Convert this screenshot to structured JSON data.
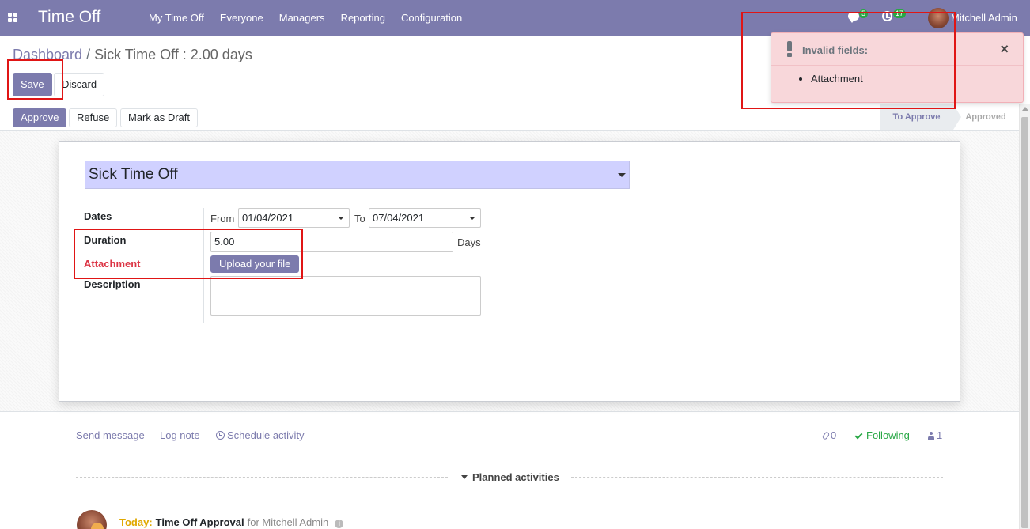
{
  "navbar": {
    "app_title": "Time Off",
    "menu": [
      "My Time Off",
      "Everyone",
      "Managers",
      "Reporting",
      "Configuration"
    ],
    "messages_count": "5",
    "activities_count": "17",
    "user_name": "Mitchell Admin"
  },
  "breadcrumb": {
    "parent": "Dashboard",
    "separator": "/",
    "current": "Sick Time Off : 2.00 days"
  },
  "toolbar": {
    "save_label": "Save",
    "discard_label": "Discard"
  },
  "statusbar": {
    "approve_label": "Approve",
    "refuse_label": "Refuse",
    "draft_label": "Mark as Draft",
    "stages": [
      "To Approve",
      "Approved"
    ],
    "active_stage": "To Approve"
  },
  "form": {
    "leave_type": "Sick Time Off",
    "dates_label": "Dates",
    "from_label": "From",
    "date_from": "01/04/2021",
    "to_label": "To",
    "date_to": "07/04/2021",
    "duration_label": "Duration",
    "duration_value": "5.00",
    "duration_unit": "Days",
    "attachment_label": "Attachment",
    "upload_label": "Upload your file",
    "description_label": "Description",
    "description_value": ""
  },
  "chatter": {
    "send_message": "Send message",
    "log_note": "Log note",
    "schedule_activity": "Schedule activity",
    "attachments_count": "0",
    "following_label": "Following",
    "followers_count": "1",
    "planned_activities_label": "Planned activities",
    "activity": {
      "due": "Today:",
      "title": "Time Off Approval",
      "assignee": "for Mitchell Admin"
    }
  },
  "notification": {
    "title": "Invalid fields:",
    "close": "×",
    "fields": [
      "Attachment"
    ]
  },
  "colors": {
    "brand": "#7c7bad",
    "invalid": "#dc3545",
    "notification_bg": "#f8d7da",
    "following": "#28a745",
    "annotation": "#e01515"
  }
}
